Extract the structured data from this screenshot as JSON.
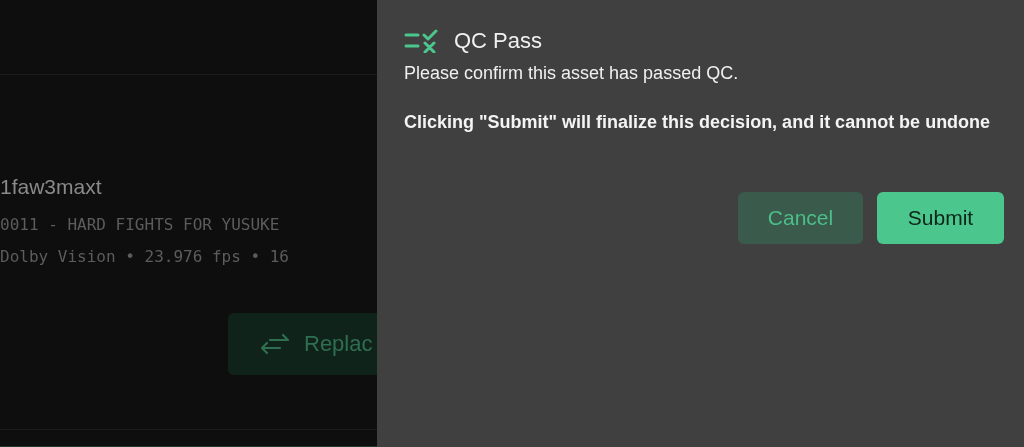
{
  "background": {
    "asset_id": "1faw3maxt",
    "episode": "0011 - HARD FIGHTS FOR YUSUKE",
    "specs": "Dolby Vision • 23.976 fps • 16",
    "replace_button": "Replac"
  },
  "dialog": {
    "title": "QC Pass",
    "message": "Please confirm this asset has passed QC.",
    "warning": "Clicking \"Submit\" will finalize this decision, and it cannot be undone",
    "buttons": [
      {
        "label": "Cancel",
        "kind": "secondary"
      },
      {
        "label": "Submit",
        "kind": "primary"
      }
    ]
  }
}
